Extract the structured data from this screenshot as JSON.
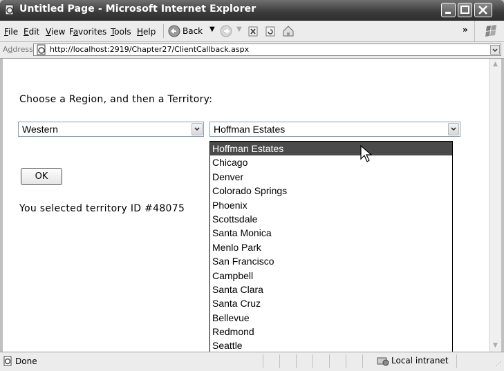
{
  "window": {
    "title": "Untitled Page - Microsoft Internet Explorer"
  },
  "menu": {
    "items": [
      "File",
      "Edit",
      "View",
      "Favorites",
      "Tools",
      "Help"
    ],
    "access_keys": [
      "F",
      "E",
      "V",
      "a",
      "T",
      "H"
    ],
    "back_label": "Back",
    "chevron": "»"
  },
  "address": {
    "label": "Address",
    "url": "http://localhost:2919/Chapter27/ClientCallback.aspx"
  },
  "page": {
    "prompt": "Choose a Region, and then a Territory:",
    "region_select": {
      "selected": "Western"
    },
    "territory_select": {
      "selected": "Hoffman Estates",
      "options": [
        "Hoffman Estates",
        "Chicago",
        "Denver",
        "Colorado Springs",
        "Phoenix",
        "Scottsdale",
        "Santa Monica",
        "Menlo Park",
        "San Francisco",
        "Campbell",
        "Santa Clara",
        "Santa Cruz",
        "Bellevue",
        "Redmond",
        "Seattle"
      ],
      "highlighted_index": 0
    },
    "ok_label": "OK",
    "result_text": "You selected territory ID #48075"
  },
  "status": {
    "text": "Done",
    "zone": "Local intranet"
  }
}
